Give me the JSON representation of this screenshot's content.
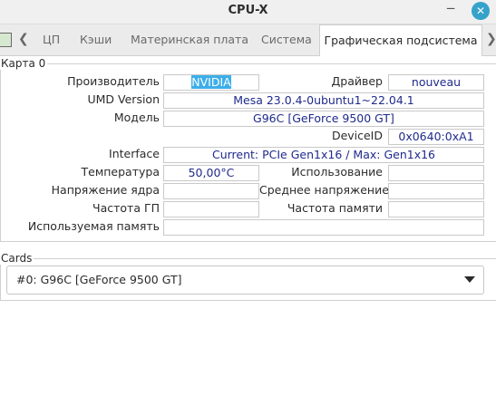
{
  "window": {
    "title": "CPU-X"
  },
  "tabs": [
    "ЦП",
    "Кэши",
    "Материнская плата",
    "Система",
    "Графическая подсистема"
  ],
  "card_frame": {
    "title": "Карта 0",
    "vendor_label": "Производитель",
    "vendor_value": "NVIDIA",
    "driver_label": "Драйвер",
    "driver_value": "nouveau",
    "umd_label": "UMD Version",
    "umd_value": "Mesa 23.0.4-0ubuntu1~22.04.1",
    "model_label": "Модель",
    "model_value": "G96C [GeForce 9500 GT]",
    "device_id_label": "DeviceID",
    "device_id_value": "0x0640:0xA1",
    "interface_label": "Interface",
    "interface_value": "Current: PCIe Gen1x16 / Max: Gen1x16",
    "temp_label": "Температура",
    "temp_value": "50,00°C",
    "usage_label": "Использование",
    "usage_value": "",
    "core_voltage_label": "Напряжение ядра",
    "core_voltage_value": "",
    "avg_voltage_label": "Среднее напряжение",
    "avg_voltage_value": "",
    "gpu_clock_label": "Частота ГП",
    "gpu_clock_value": "",
    "mem_clock_label": "Частота памяти",
    "mem_clock_value": "",
    "used_mem_label": "Используемая память",
    "used_mem_value": ""
  },
  "cards": {
    "title": "Cards",
    "selected": "#0: G96C [GeForce 9500 GT]"
  },
  "colors": {
    "accent": "#3daee9",
    "value_text": "#1f2a8c",
    "close_button": "#35a3c9"
  }
}
